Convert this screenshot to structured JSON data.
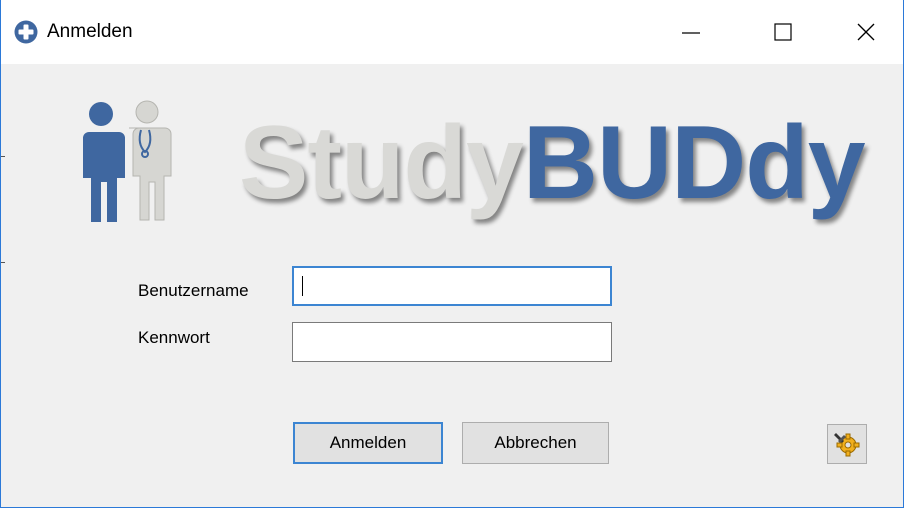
{
  "window": {
    "title": "Anmelden",
    "icon": "plus-circle-icon",
    "controls": {
      "minimize": "minimize-icon",
      "maximize": "maximize-icon",
      "close": "close-icon"
    }
  },
  "logo": {
    "part1": "Study",
    "part2": "BUDdy",
    "part1_color": "#d9d9d6",
    "part2_color": "#3f67a0",
    "figures_icon": "patient-doctor-icon"
  },
  "form": {
    "username_label": "Benutzername",
    "username_value": "",
    "password_label": "Kennwort",
    "password_value": ""
  },
  "buttons": {
    "login": "Anmelden",
    "cancel": "Abbrechen",
    "settings_icon": "gear-settings-icon"
  },
  "colors": {
    "accent": "#3c85d2",
    "window_border": "#2b79d8",
    "background": "#f0f0f0"
  }
}
